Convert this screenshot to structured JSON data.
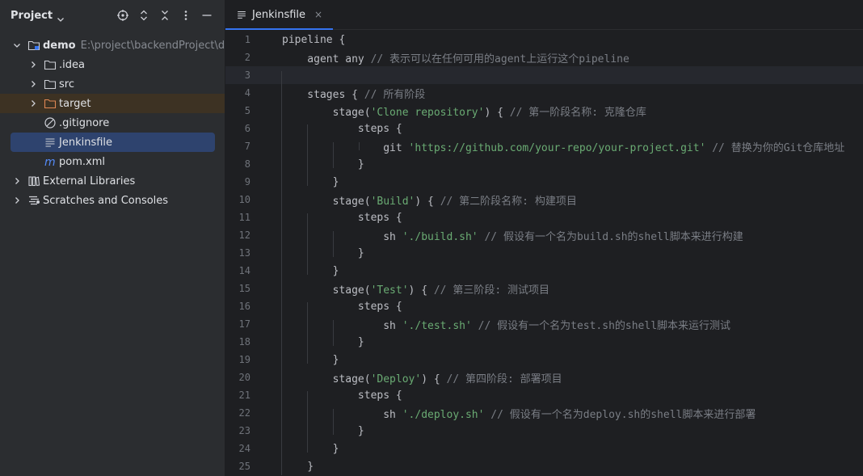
{
  "project_panel": {
    "title": "Project",
    "tools": [
      "locate-icon",
      "expand-all-icon",
      "collapse-all-icon",
      "options-icon",
      "hide-icon"
    ],
    "tree": [
      {
        "label": "demo",
        "path": "E:\\project\\backendProject\\demo",
        "icon": "module-folder-icon",
        "expanded": true,
        "depth": 0
      },
      {
        "label": ".idea",
        "icon": "folder-icon",
        "expanded": false,
        "depth": 1
      },
      {
        "label": "src",
        "icon": "folder-icon",
        "expanded": false,
        "depth": 1
      },
      {
        "label": "target",
        "icon": "excluded-folder-icon",
        "expanded": false,
        "depth": 1
      },
      {
        "label": ".gitignore",
        "icon": "ignore-file-icon",
        "depth": 1
      },
      {
        "label": "Jenkinsfile",
        "icon": "text-file-icon",
        "depth": 1,
        "selected": true
      },
      {
        "label": "pom.xml",
        "icon": "maven-icon",
        "depth": 1
      },
      {
        "label": "External Libraries",
        "icon": "libraries-icon",
        "expanded": false,
        "depth": 0
      },
      {
        "label": "Scratches and Consoles",
        "icon": "scratches-icon",
        "expanded": false,
        "depth": 0
      }
    ]
  },
  "editor": {
    "tab": {
      "label": "Jenkinsfile",
      "close": "×"
    },
    "current_line": 3,
    "lines": [
      {
        "n": "1",
        "tokens": [
          {
            "t": "pipeline {",
            "c": "kw"
          }
        ]
      },
      {
        "n": "2",
        "tokens": [
          {
            "t": "    agent any ",
            "c": "kw"
          },
          {
            "t": "// 表示可以在任何可用的agent上运行这个pipeline",
            "c": "com"
          }
        ]
      },
      {
        "n": "3",
        "tokens": []
      },
      {
        "n": "4",
        "tokens": [
          {
            "t": "    stages { ",
            "c": "kw"
          },
          {
            "t": "// 所有阶段",
            "c": "com"
          }
        ]
      },
      {
        "n": "5",
        "tokens": [
          {
            "t": "        stage(",
            "c": "kw"
          },
          {
            "t": "'Clone repository'",
            "c": "str"
          },
          {
            "t": ") { ",
            "c": "kw"
          },
          {
            "t": "// 第一阶段名称: 克隆仓库",
            "c": "com"
          }
        ]
      },
      {
        "n": "6",
        "tokens": [
          {
            "t": "            steps {",
            "c": "kw"
          }
        ]
      },
      {
        "n": "7",
        "tokens": [
          {
            "t": "                git ",
            "c": "kw"
          },
          {
            "t": "'https://github.com/your-repo/your-project.git'",
            "c": "str"
          },
          {
            "t": " ",
            "c": "kw"
          },
          {
            "t": "// 替换为你的Git仓库地址",
            "c": "com"
          }
        ]
      },
      {
        "n": "8",
        "tokens": [
          {
            "t": "            }",
            "c": "kw"
          }
        ]
      },
      {
        "n": "9",
        "tokens": [
          {
            "t": "        }",
            "c": "kw"
          }
        ]
      },
      {
        "n": "10",
        "tokens": [
          {
            "t": "        stage(",
            "c": "kw"
          },
          {
            "t": "'Build'",
            "c": "str"
          },
          {
            "t": ") { ",
            "c": "kw"
          },
          {
            "t": "// 第二阶段名称: 构建项目",
            "c": "com"
          }
        ]
      },
      {
        "n": "11",
        "tokens": [
          {
            "t": "            steps {",
            "c": "kw"
          }
        ]
      },
      {
        "n": "12",
        "tokens": [
          {
            "t": "                sh ",
            "c": "kw"
          },
          {
            "t": "'./build.sh'",
            "c": "str"
          },
          {
            "t": " ",
            "c": "kw"
          },
          {
            "t": "// 假设有一个名为build.sh的shell脚本来进行构建",
            "c": "com"
          }
        ]
      },
      {
        "n": "13",
        "tokens": [
          {
            "t": "            }",
            "c": "kw"
          }
        ]
      },
      {
        "n": "14",
        "tokens": [
          {
            "t": "        }",
            "c": "kw"
          }
        ]
      },
      {
        "n": "15",
        "tokens": [
          {
            "t": "        stage(",
            "c": "kw"
          },
          {
            "t": "'Test'",
            "c": "str"
          },
          {
            "t": ") { ",
            "c": "kw"
          },
          {
            "t": "// 第三阶段: 测试项目",
            "c": "com"
          }
        ]
      },
      {
        "n": "16",
        "tokens": [
          {
            "t": "            steps {",
            "c": "kw"
          }
        ]
      },
      {
        "n": "17",
        "tokens": [
          {
            "t": "                sh ",
            "c": "kw"
          },
          {
            "t": "'./test.sh'",
            "c": "str"
          },
          {
            "t": " ",
            "c": "kw"
          },
          {
            "t": "// 假设有一个名为test.sh的shell脚本来运行测试",
            "c": "com"
          }
        ]
      },
      {
        "n": "18",
        "tokens": [
          {
            "t": "            }",
            "c": "kw"
          }
        ]
      },
      {
        "n": "19",
        "tokens": [
          {
            "t": "        }",
            "c": "kw"
          }
        ]
      },
      {
        "n": "20",
        "tokens": [
          {
            "t": "        stage(",
            "c": "kw"
          },
          {
            "t": "'Deploy'",
            "c": "str"
          },
          {
            "t": ") { ",
            "c": "kw"
          },
          {
            "t": "// 第四阶段: 部署项目",
            "c": "com"
          }
        ]
      },
      {
        "n": "21",
        "tokens": [
          {
            "t": "            steps {",
            "c": "kw"
          }
        ]
      },
      {
        "n": "22",
        "tokens": [
          {
            "t": "                sh ",
            "c": "kw"
          },
          {
            "t": "'./deploy.sh'",
            "c": "str"
          },
          {
            "t": " ",
            "c": "kw"
          },
          {
            "t": "// 假设有一个名为deploy.sh的shell脚本来进行部署",
            "c": "com"
          }
        ]
      },
      {
        "n": "23",
        "tokens": [
          {
            "t": "            }",
            "c": "kw"
          }
        ]
      },
      {
        "n": "24",
        "tokens": [
          {
            "t": "        }",
            "c": "kw"
          }
        ]
      },
      {
        "n": "25",
        "tokens": [
          {
            "t": "    }",
            "c": "kw"
          }
        ]
      }
    ]
  },
  "colors": {
    "panel_bg": "#2b2d30",
    "editor_bg": "#1e1f22",
    "selection": "#2e436e",
    "excluded_row": "#3d3223",
    "string": "#6aab73",
    "comment": "#7a7e85",
    "text": "#bcbec4",
    "accent": "#3574f0"
  }
}
